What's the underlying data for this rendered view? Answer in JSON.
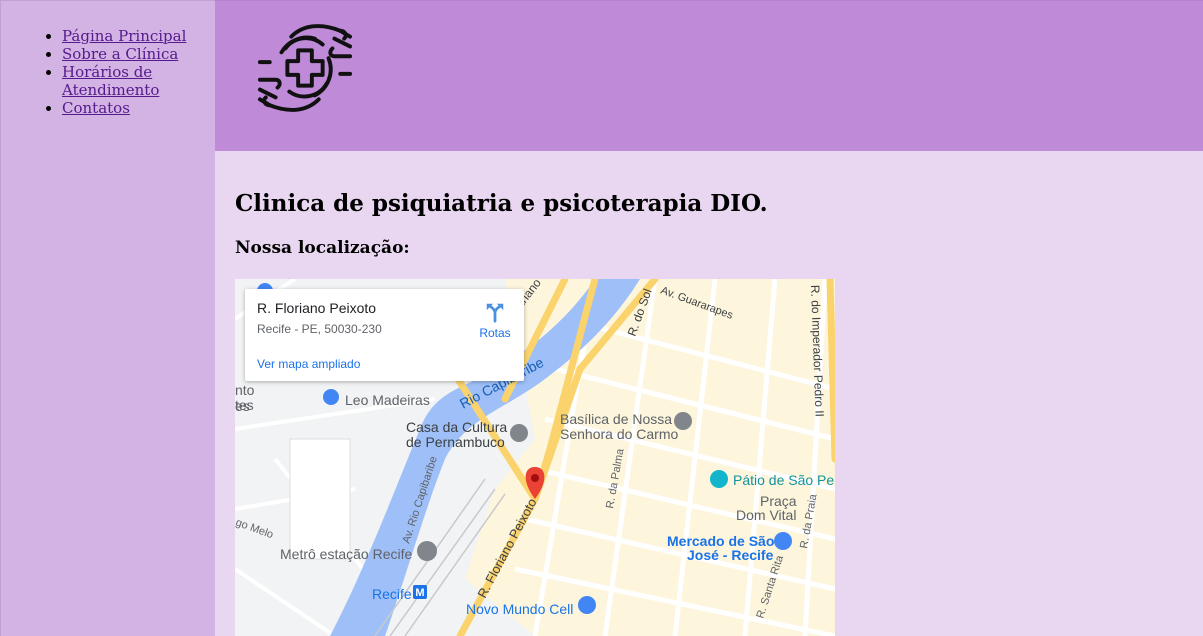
{
  "nav": {
    "items": [
      {
        "label": "Página Principal"
      },
      {
        "label": "Sobre a Clínica"
      },
      {
        "label": "Horários de Atendimento"
      },
      {
        "label": "Contatos"
      }
    ]
  },
  "header": {
    "logo_icon": "medical-cross-hands-icon"
  },
  "main": {
    "title": "Clinica de psiquiatria e psicoterapia DIO.",
    "subtitle": "Nossa localização:"
  },
  "map": {
    "card": {
      "place_name": "R. Floriano Peixoto",
      "address": "Recife - PE, 50030-230",
      "larger_map_link": "Ver mapa ampliado",
      "directions_label": "Rotas"
    },
    "labels": {
      "leo_madeiras": "Leo Madeiras",
      "rio_capibaribe": "Rio Capibaribe",
      "basilica_1": "Basílica de Nossa",
      "basilica_2": "Senhora do Carmo",
      "casa_cultura_1": "Casa da Cultura",
      "casa_cultura_2": "de Pernambuco",
      "patio": "Pátio de São Pe",
      "praca_1": "Praça",
      "praca_2": "Dom Vital",
      "mercado_1": "Mercado de São",
      "mercado_2": "José - Recife",
      "metro": "Metrô estação Recife",
      "recife": "Recife",
      "metro_badge": "M",
      "novo_mundo": "Novo Mundo Cell",
      "av_guararapes": "Av. Guararapes",
      "r_do_sol": "R. do Sol",
      "r_imperador": "R. do Imperador Pedro II",
      "r_floriano": "R. Floriano Peixoto",
      "av_rio_capibaribe": "Av. Rio Capibaribe",
      "r_da_palma": "R. da Palma",
      "r_da_praia": "R. da Praia",
      "r_santa_rita": "R. Santa Rita",
      "mariano": "ariano",
      "go_melo": "go Melo",
      "cut_left_1": "nto",
      "cut_left_2": "tes",
      "cut_left_3": "es"
    }
  },
  "colors": {
    "sidebar": "#d3b2e4",
    "header": "#bf8bd8",
    "content": "#e9d7f1",
    "link": "#551a8b",
    "river": "#9ebff7",
    "main_road": "#fbd36d",
    "urban_area": "#fdf5dc",
    "pin": "#ea4335"
  }
}
